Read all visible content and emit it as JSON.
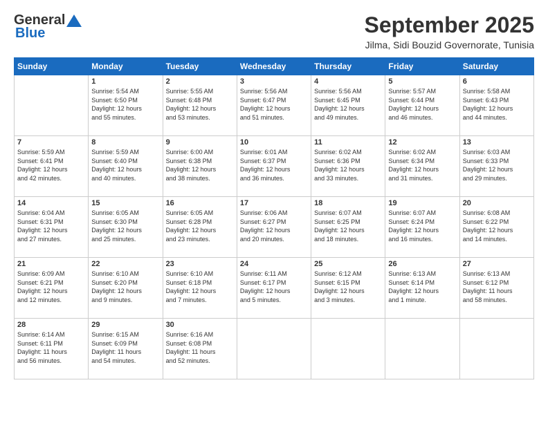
{
  "logo": {
    "line1": "General",
    "line2": "Blue"
  },
  "title": "September 2025",
  "location": "Jilma, Sidi Bouzid Governorate, Tunisia",
  "days_header": [
    "Sunday",
    "Monday",
    "Tuesday",
    "Wednesday",
    "Thursday",
    "Friday",
    "Saturday"
  ],
  "weeks": [
    [
      {
        "day": "",
        "info": ""
      },
      {
        "day": "1",
        "info": "Sunrise: 5:54 AM\nSunset: 6:50 PM\nDaylight: 12 hours\nand 55 minutes."
      },
      {
        "day": "2",
        "info": "Sunrise: 5:55 AM\nSunset: 6:48 PM\nDaylight: 12 hours\nand 53 minutes."
      },
      {
        "day": "3",
        "info": "Sunrise: 5:56 AM\nSunset: 6:47 PM\nDaylight: 12 hours\nand 51 minutes."
      },
      {
        "day": "4",
        "info": "Sunrise: 5:56 AM\nSunset: 6:45 PM\nDaylight: 12 hours\nand 49 minutes."
      },
      {
        "day": "5",
        "info": "Sunrise: 5:57 AM\nSunset: 6:44 PM\nDaylight: 12 hours\nand 46 minutes."
      },
      {
        "day": "6",
        "info": "Sunrise: 5:58 AM\nSunset: 6:43 PM\nDaylight: 12 hours\nand 44 minutes."
      }
    ],
    [
      {
        "day": "7",
        "info": "Sunrise: 5:59 AM\nSunset: 6:41 PM\nDaylight: 12 hours\nand 42 minutes."
      },
      {
        "day": "8",
        "info": "Sunrise: 5:59 AM\nSunset: 6:40 PM\nDaylight: 12 hours\nand 40 minutes."
      },
      {
        "day": "9",
        "info": "Sunrise: 6:00 AM\nSunset: 6:38 PM\nDaylight: 12 hours\nand 38 minutes."
      },
      {
        "day": "10",
        "info": "Sunrise: 6:01 AM\nSunset: 6:37 PM\nDaylight: 12 hours\nand 36 minutes."
      },
      {
        "day": "11",
        "info": "Sunrise: 6:02 AM\nSunset: 6:36 PM\nDaylight: 12 hours\nand 33 minutes."
      },
      {
        "day": "12",
        "info": "Sunrise: 6:02 AM\nSunset: 6:34 PM\nDaylight: 12 hours\nand 31 minutes."
      },
      {
        "day": "13",
        "info": "Sunrise: 6:03 AM\nSunset: 6:33 PM\nDaylight: 12 hours\nand 29 minutes."
      }
    ],
    [
      {
        "day": "14",
        "info": "Sunrise: 6:04 AM\nSunset: 6:31 PM\nDaylight: 12 hours\nand 27 minutes."
      },
      {
        "day": "15",
        "info": "Sunrise: 6:05 AM\nSunset: 6:30 PM\nDaylight: 12 hours\nand 25 minutes."
      },
      {
        "day": "16",
        "info": "Sunrise: 6:05 AM\nSunset: 6:28 PM\nDaylight: 12 hours\nand 23 minutes."
      },
      {
        "day": "17",
        "info": "Sunrise: 6:06 AM\nSunset: 6:27 PM\nDaylight: 12 hours\nand 20 minutes."
      },
      {
        "day": "18",
        "info": "Sunrise: 6:07 AM\nSunset: 6:25 PM\nDaylight: 12 hours\nand 18 minutes."
      },
      {
        "day": "19",
        "info": "Sunrise: 6:07 AM\nSunset: 6:24 PM\nDaylight: 12 hours\nand 16 minutes."
      },
      {
        "day": "20",
        "info": "Sunrise: 6:08 AM\nSunset: 6:22 PM\nDaylight: 12 hours\nand 14 minutes."
      }
    ],
    [
      {
        "day": "21",
        "info": "Sunrise: 6:09 AM\nSunset: 6:21 PM\nDaylight: 12 hours\nand 12 minutes."
      },
      {
        "day": "22",
        "info": "Sunrise: 6:10 AM\nSunset: 6:20 PM\nDaylight: 12 hours\nand 9 minutes."
      },
      {
        "day": "23",
        "info": "Sunrise: 6:10 AM\nSunset: 6:18 PM\nDaylight: 12 hours\nand 7 minutes."
      },
      {
        "day": "24",
        "info": "Sunrise: 6:11 AM\nSunset: 6:17 PM\nDaylight: 12 hours\nand 5 minutes."
      },
      {
        "day": "25",
        "info": "Sunrise: 6:12 AM\nSunset: 6:15 PM\nDaylight: 12 hours\nand 3 minutes."
      },
      {
        "day": "26",
        "info": "Sunrise: 6:13 AM\nSunset: 6:14 PM\nDaylight: 12 hours\nand 1 minute."
      },
      {
        "day": "27",
        "info": "Sunrise: 6:13 AM\nSunset: 6:12 PM\nDaylight: 11 hours\nand 58 minutes."
      }
    ],
    [
      {
        "day": "28",
        "info": "Sunrise: 6:14 AM\nSunset: 6:11 PM\nDaylight: 11 hours\nand 56 minutes."
      },
      {
        "day": "29",
        "info": "Sunrise: 6:15 AM\nSunset: 6:09 PM\nDaylight: 11 hours\nand 54 minutes."
      },
      {
        "day": "30",
        "info": "Sunrise: 6:16 AM\nSunset: 6:08 PM\nDaylight: 11 hours\nand 52 minutes."
      },
      {
        "day": "",
        "info": ""
      },
      {
        "day": "",
        "info": ""
      },
      {
        "day": "",
        "info": ""
      },
      {
        "day": "",
        "info": ""
      }
    ]
  ]
}
